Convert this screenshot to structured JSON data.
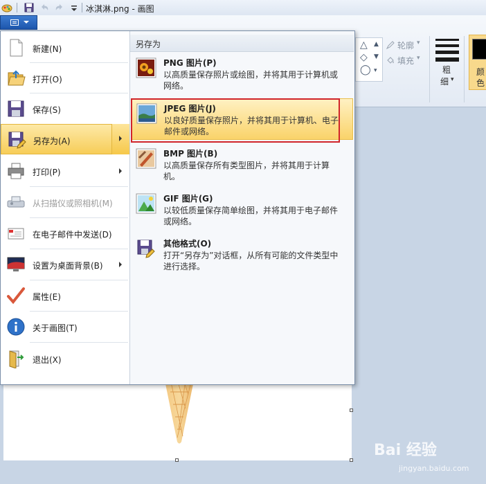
{
  "window": {
    "title": "冰淇淋.png - 画图"
  },
  "ribbon": {
    "outline_label": "轮廓",
    "fill_label": "填充",
    "size_label_1": "粗",
    "size_label_2": "细",
    "color_label_1": "颜",
    "color_label_2": "色"
  },
  "menu": {
    "items": [
      {
        "label": "新建(N)",
        "icon": "new-document-icon",
        "interactable": true
      },
      {
        "label": "打开(O)",
        "icon": "open-folder-icon",
        "interactable": true
      },
      {
        "label": "保存(S)",
        "icon": "save-disk-icon",
        "interactable": true
      },
      {
        "label": "另存为(A)",
        "icon": "save-as-icon",
        "interactable": true,
        "selected": true,
        "has_submenu": true
      },
      {
        "label": "打印(P)",
        "icon": "printer-icon",
        "interactable": true,
        "has_submenu": true
      },
      {
        "label": "从扫描仪或照相机(M)",
        "icon": "scanner-icon",
        "interactable": false,
        "disabled": true
      },
      {
        "label": "在电子邮件中发送(D)",
        "icon": "email-icon",
        "interactable": true
      },
      {
        "label": "设置为桌面背景(B)",
        "icon": "desktop-background-icon",
        "interactable": true,
        "has_submenu": true
      },
      {
        "label": "属性(E)",
        "icon": "properties-check-icon",
        "interactable": true
      },
      {
        "label": "关于画图(T)",
        "icon": "info-icon",
        "interactable": true
      },
      {
        "label": "退出(X)",
        "icon": "exit-icon",
        "interactable": true
      }
    ]
  },
  "saveas": {
    "header": "另存为",
    "options": [
      {
        "title": "PNG 图片(P)",
        "desc": "以高质量保存照片或绘图，并将其用于计算机或网络。",
        "icon": "png-image-icon"
      },
      {
        "title": "JPEG 图片(J)",
        "desc": "以良好质量保存照片，并将其用于计算机、电子邮件或网络。",
        "icon": "jpeg-image-icon",
        "selected": true
      },
      {
        "title": "BMP 图片(B)",
        "desc": "以高质量保存所有类型图片，并将其用于计算机。",
        "icon": "bmp-image-icon"
      },
      {
        "title": "GIF 图片(G)",
        "desc": "以较低质量保存简单绘图，并将其用于电子邮件或网络。",
        "icon": "gif-image-icon"
      },
      {
        "title": "其他格式(O)",
        "desc": "打开“另存为”对话框，从所有可能的文件类型中进行选择。",
        "icon": "other-formats-icon"
      }
    ]
  },
  "watermark": {
    "main": "Bai 经验",
    "sub": "jingyan.baidu.com"
  },
  "colors": {
    "accent": "#1d56ad",
    "highlight": "#f7cd58",
    "annotation_red": "#d0242a"
  }
}
